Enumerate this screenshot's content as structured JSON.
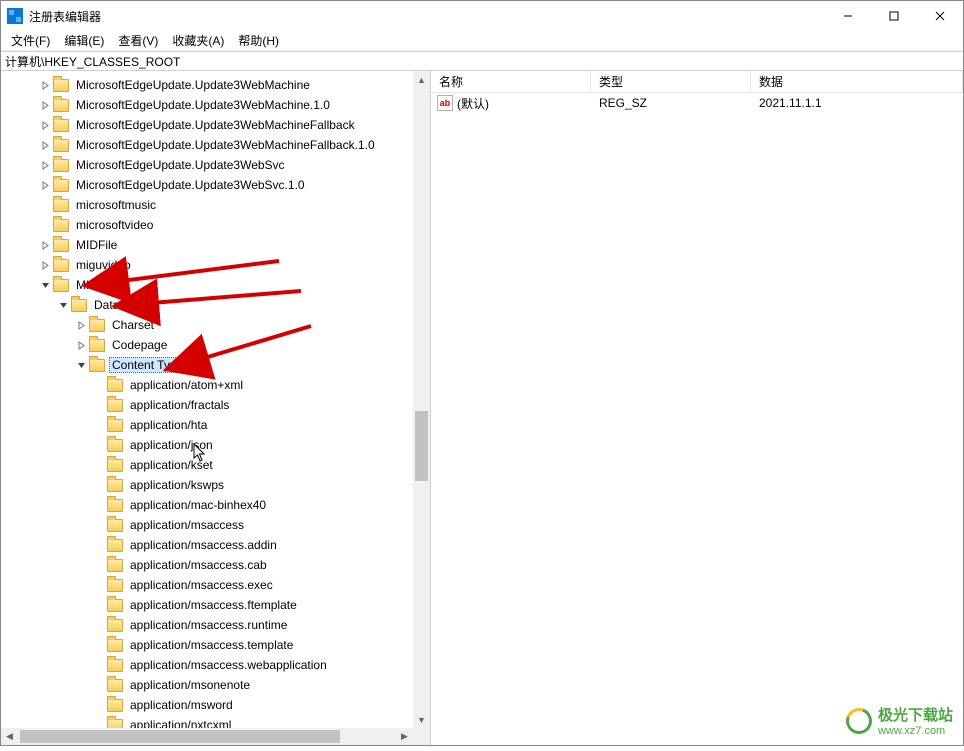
{
  "window": {
    "title": "注册表编辑器",
    "min_tip": "最小化",
    "max_tip": "最大化",
    "close_tip": "关闭"
  },
  "menu": {
    "items": [
      "文件(F)",
      "编辑(E)",
      "查看(V)",
      "收藏夹(A)",
      "帮助(H)"
    ]
  },
  "address": "计算机\\HKEY_CLASSES_ROOT",
  "tree": [
    {
      "indent": 1,
      "exp": ">",
      "label": "MicrosoftEdgeUpdate.Update3WebMachine"
    },
    {
      "indent": 1,
      "exp": ">",
      "label": "MicrosoftEdgeUpdate.Update3WebMachine.1.0"
    },
    {
      "indent": 1,
      "exp": ">",
      "label": "MicrosoftEdgeUpdate.Update3WebMachineFallback"
    },
    {
      "indent": 1,
      "exp": ">",
      "label": "MicrosoftEdgeUpdate.Update3WebMachineFallback.1.0"
    },
    {
      "indent": 1,
      "exp": ">",
      "label": "MicrosoftEdgeUpdate.Update3WebSvc"
    },
    {
      "indent": 1,
      "exp": ">",
      "label": "MicrosoftEdgeUpdate.Update3WebSvc.1.0"
    },
    {
      "indent": 1,
      "exp": " ",
      "label": "microsoftmusic"
    },
    {
      "indent": 1,
      "exp": " ",
      "label": "microsoftvideo"
    },
    {
      "indent": 1,
      "exp": ">",
      "label": "MIDFile"
    },
    {
      "indent": 1,
      "exp": ">",
      "label": "miguvideo"
    },
    {
      "indent": 1,
      "exp": "v",
      "label": "MIME"
    },
    {
      "indent": 2,
      "exp": "v",
      "label": "Database"
    },
    {
      "indent": 3,
      "exp": ">",
      "label": "Charset"
    },
    {
      "indent": 3,
      "exp": ">",
      "label": "Codepage"
    },
    {
      "indent": 3,
      "exp": "v",
      "label": "Content Type",
      "selected": true
    },
    {
      "indent": 4,
      "exp": " ",
      "label": "application/atom+xml"
    },
    {
      "indent": 4,
      "exp": " ",
      "label": "application/fractals"
    },
    {
      "indent": 4,
      "exp": " ",
      "label": "application/hta"
    },
    {
      "indent": 4,
      "exp": " ",
      "label": "application/json"
    },
    {
      "indent": 4,
      "exp": " ",
      "label": "application/kset"
    },
    {
      "indent": 4,
      "exp": " ",
      "label": "application/kswps"
    },
    {
      "indent": 4,
      "exp": " ",
      "label": "application/mac-binhex40"
    },
    {
      "indent": 4,
      "exp": " ",
      "label": "application/msaccess"
    },
    {
      "indent": 4,
      "exp": " ",
      "label": "application/msaccess.addin"
    },
    {
      "indent": 4,
      "exp": " ",
      "label": "application/msaccess.cab"
    },
    {
      "indent": 4,
      "exp": " ",
      "label": "application/msaccess.exec"
    },
    {
      "indent": 4,
      "exp": " ",
      "label": "application/msaccess.ftemplate"
    },
    {
      "indent": 4,
      "exp": " ",
      "label": "application/msaccess.runtime"
    },
    {
      "indent": 4,
      "exp": " ",
      "label": "application/msaccess.template"
    },
    {
      "indent": 4,
      "exp": " ",
      "label": "application/msaccess.webapplication"
    },
    {
      "indent": 4,
      "exp": " ",
      "label": "application/msonenote"
    },
    {
      "indent": 4,
      "exp": " ",
      "label": "application/msword"
    },
    {
      "indent": 4,
      "exp": " ",
      "label": "application/nxtcxml"
    }
  ],
  "list": {
    "headers": {
      "name": "名称",
      "type": "类型",
      "data": "数据"
    },
    "icon_text": "ab",
    "rows": [
      {
        "name": "(默认)",
        "type": "REG_SZ",
        "data": "2021.11.1.1"
      }
    ]
  },
  "watermark": {
    "brand": "极光下载站",
    "url": "www.xz7.com"
  }
}
